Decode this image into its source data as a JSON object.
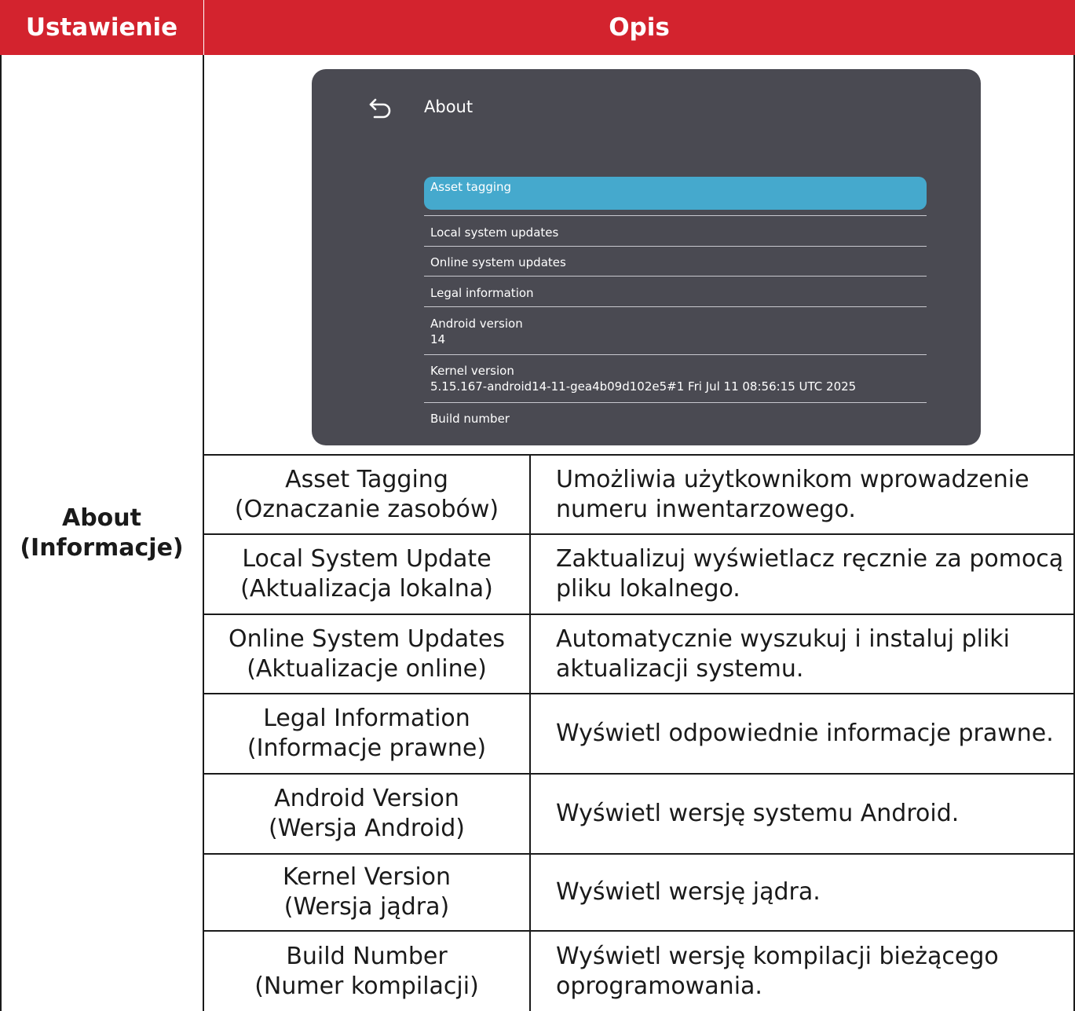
{
  "table": {
    "header": {
      "col1": "Ustawienie",
      "col2": "Opis"
    },
    "setting": {
      "line1": "About",
      "line2": "(Informacje)"
    },
    "rows": [
      {
        "name1": "Asset Tagging",
        "name2": "(Oznaczanie zasobów)",
        "desc1": "Umożliwia użytkownikom wprowadzenie",
        "desc2": "numeru inwentarzowego."
      },
      {
        "name1": "Local System Update",
        "name2": "(Aktualizacja lokalna)",
        "desc1": "Zaktualizuj wyświetlacz ręcznie za pomocą",
        "desc2": "pliku lokalnego."
      },
      {
        "name1": "Online System Updates",
        "name2": "(Aktualizacje online)",
        "desc1": "Automatycznie wyszukuj i instaluj pliki",
        "desc2": "aktualizacji systemu."
      },
      {
        "name1": "Legal Information",
        "name2": "(Informacje prawne)",
        "desc1": "Wyświetl odpowiednie informacje prawne.",
        "desc2": ""
      },
      {
        "name1": "Android Version",
        "name2": "(Wersja Android)",
        "desc1": "Wyświetl wersję systemu Android.",
        "desc2": ""
      },
      {
        "name1": "Kernel Version",
        "name2": "(Wersja jądra)",
        "desc1": "Wyświetl wersję jądra.",
        "desc2": ""
      },
      {
        "name1": "Build Number",
        "name2": "(Numer kompilacji)",
        "desc1": "Wyświetl wersję kompilacji bieżącego",
        "desc2": "oprogramowania."
      }
    ]
  },
  "screenshot": {
    "title": "About",
    "icon": "back-arrow-icon",
    "items": [
      {
        "label": "Asset tagging",
        "value": ""
      },
      {
        "label": "Local system updates",
        "value": ""
      },
      {
        "label": "Online system updates",
        "value": ""
      },
      {
        "label": "Legal information",
        "value": ""
      },
      {
        "label": "Android version",
        "value": "14"
      },
      {
        "label": "Kernel version",
        "value": "5.15.167-android14-11-gea4b09d102e5#1 Fri Jul 11 08:56:15 UTC 2025"
      },
      {
        "label": "Build number",
        "value": ""
      }
    ]
  },
  "colors": {
    "header_bg": "#d3232e",
    "screen_bg": "#4a4a52",
    "highlight": "#45a9cd"
  }
}
